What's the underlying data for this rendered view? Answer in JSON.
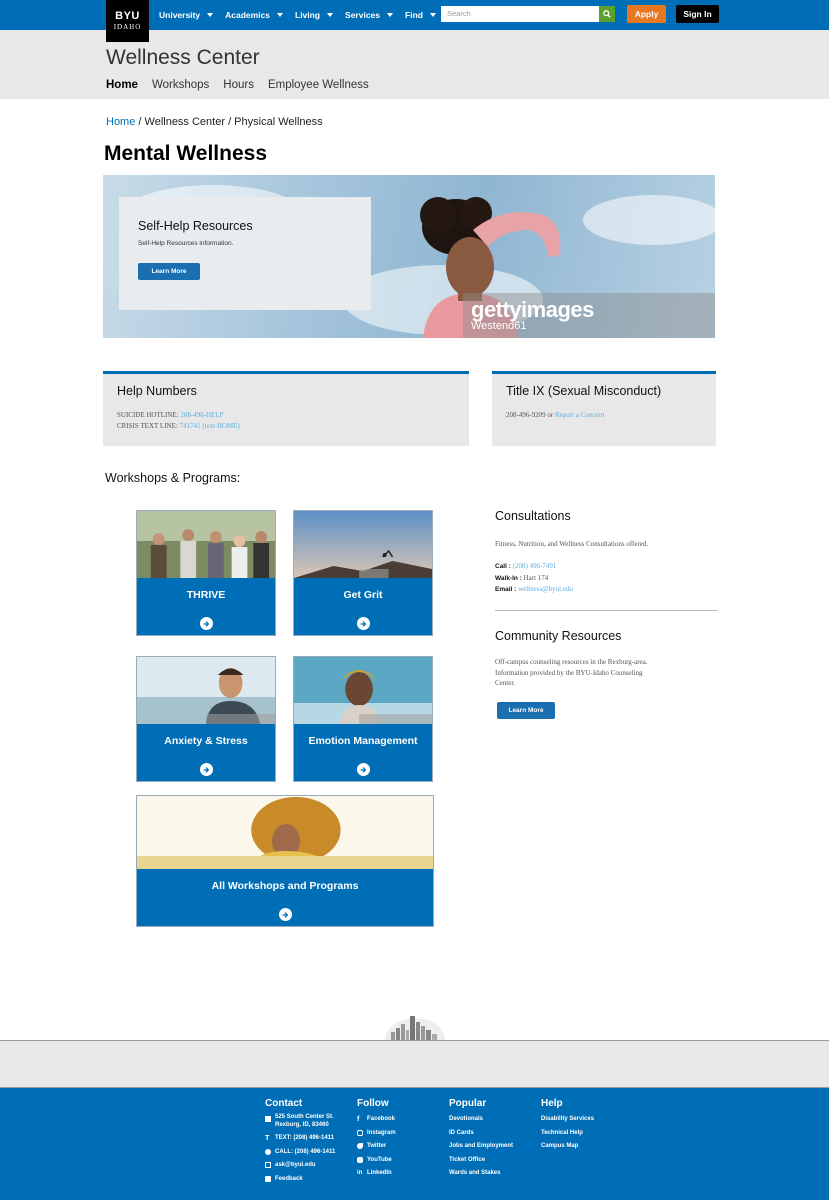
{
  "logo": {
    "line1": "BYU",
    "line2": "IDAHO"
  },
  "nav": [
    "University",
    "Academics",
    "Living",
    "Services",
    "Find"
  ],
  "search": {
    "placeholder": "Search"
  },
  "apply": "Apply",
  "signin": "Sign In",
  "site_title": "Wellness Center",
  "subnav": [
    "Home",
    "Workshops",
    "Hours",
    "Employee Wellness"
  ],
  "breadcrumb": {
    "home": "Home",
    "rest": " / Wellness Center / Physical Wellness"
  },
  "page_title": "Mental Wellness",
  "hero": {
    "title": "Self-Help Resources",
    "text": "Self-Help Resources information.",
    "button": "Learn More",
    "watermark_brand": "gettyimages",
    "watermark_credit": "Westend61"
  },
  "help": {
    "title": "Help Numbers",
    "suicide_label": "SUICIDE HOTLINE:",
    "suicide_value": "208-496-HELP",
    "crisis_label": "CRISIS TEXT LINE:",
    "crisis_value": "741741 (text HOME)"
  },
  "title9": {
    "title": "Title IX (Sexual Misconduct)",
    "phone": "208-496-9209 or ",
    "link": "Report a Concern"
  },
  "workshops_title": "Workshops & Programs:",
  "tiles": [
    "THRIVE",
    "Get Grit",
    "Anxiety & Stress",
    "Emotion Management",
    "All Workshops and Programs"
  ],
  "consultations": {
    "title": "Consultations",
    "text": "Fitness, Nutrition, and Wellness Consultations offered.",
    "call_label": "Call :",
    "call_value": "(208) 496-7491",
    "walkin_label": "Walk-In :",
    "walkin_value": "Hart 174",
    "email_label": "Email :",
    "email_value": "wellness@byui.edu"
  },
  "community": {
    "title": "Community Resources",
    "text1": "Off-campus counseling resources in the Rexburg-area.",
    "text2": "Information provided by the BYU-Idaho Counseling",
    "text3": "Center.",
    "button": "Learn More"
  },
  "footer": {
    "contact": {
      "title": "Contact",
      "address1": "525 South Center St.",
      "address2": "Rexburg, ID, 83460",
      "text": "TEXT: (208) 496-1411",
      "call": "CALL: (208) 496-1411",
      "email": "ask@byui.edu",
      "feedback": "Feedback"
    },
    "follow": {
      "title": "Follow",
      "items": [
        "Facebook",
        "Instagram",
        "Twitter",
        "YouTube",
        "LinkedIn"
      ]
    },
    "popular": {
      "title": "Popular",
      "items": [
        "Devotionals",
        "ID Cards",
        "Jobs and Employment",
        "Ticket Office",
        "Wards and Stakes"
      ]
    },
    "help": {
      "title": "Help",
      "items": [
        "Disability Services",
        "Technical Help",
        "Campus Map"
      ]
    }
  },
  "colors": {
    "brand_blue": "#006eb6",
    "apply_orange": "#e87722",
    "search_green": "#5aa02c",
    "link_light_blue": "#5aaee0"
  }
}
